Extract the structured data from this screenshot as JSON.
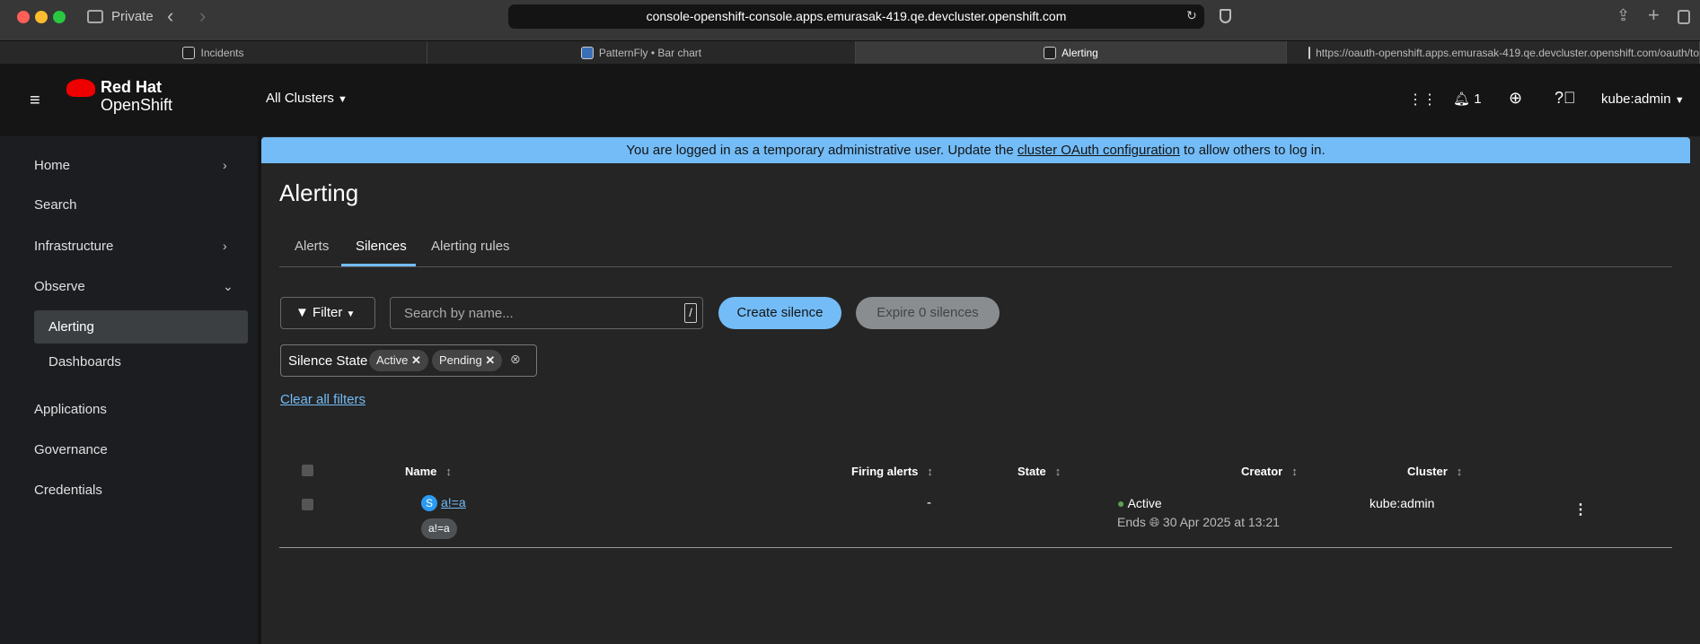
{
  "browser": {
    "mode": "Private",
    "url": "console-openshift-console.apps.emurasak-419.qe.devcluster.openshift.com",
    "tabs": [
      {
        "label": "Incidents"
      },
      {
        "label": "PatternFly • Bar chart"
      },
      {
        "label": "Alerting"
      },
      {
        "label": "https://oauth-openshift.apps.emurasak-419.qe.devcluster.openshift.com/oauth/to"
      }
    ]
  },
  "masthead": {
    "brand_line1": "Red Hat",
    "brand_line2": "OpenShift",
    "cluster_selector": "All Clusters",
    "notification_count": "1",
    "user": "kube:admin"
  },
  "sidebar": {
    "items": [
      {
        "label": "Home"
      },
      {
        "label": "Search"
      },
      {
        "label": "Infrastructure"
      },
      {
        "label": "Observe"
      },
      {
        "label": "Alerting"
      },
      {
        "label": "Dashboards"
      },
      {
        "label": "Applications"
      },
      {
        "label": "Governance"
      },
      {
        "label": "Credentials"
      }
    ]
  },
  "banner": {
    "text_before": "You are logged in as a temporary administrative user. Update the ",
    "link": "cluster OAuth configuration",
    "text_after": " to allow others to log in."
  },
  "page": {
    "title": "Alerting",
    "tabs": [
      {
        "label": "Alerts"
      },
      {
        "label": "Silences"
      },
      {
        "label": "Alerting rules"
      }
    ],
    "filter_label": "Filter",
    "search_placeholder": "Search by name...",
    "search_shortcut": "/",
    "create_button": "Create silence",
    "expire_button": "Expire 0 silences",
    "chip_group_label": "Silence State",
    "chips": [
      "Active",
      "Pending"
    ],
    "clear_filters": "Clear all filters"
  },
  "table": {
    "columns": [
      "Name",
      "Firing alerts",
      "State",
      "Creator",
      "Cluster"
    ],
    "rows": [
      {
        "badge": "S",
        "name": "a!=a",
        "matcher": "a!=a",
        "firing_alerts": "-",
        "state": "Active",
        "ends_label": "Ends",
        "ends": "30 Apr 2025 at 13:21",
        "creator": "kube:admin"
      }
    ]
  },
  "colors": {
    "accent": "#73bcf7",
    "success": "#5ba352",
    "brand_red": "#ee0000"
  }
}
